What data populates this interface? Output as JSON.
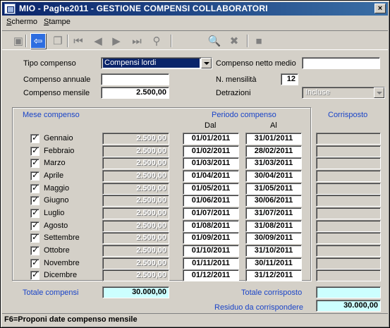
{
  "window": {
    "title": "MIO - Paghe2011 - GESTIONE COMPENSI COLLABORATORI",
    "close_label": "×"
  },
  "menu": [
    {
      "underline": "S",
      "rest": "chermo"
    },
    {
      "underline": "S",
      "rest": "tampe"
    }
  ],
  "toolbar": [
    {
      "name": "save-icon",
      "glyph": "▣",
      "active": false
    },
    {
      "name": "back-arrow-icon",
      "glyph": "⇦",
      "active": true
    },
    {
      "name": "pages-icon",
      "glyph": "❐",
      "active": false
    },
    {
      "name": "first-record-icon",
      "glyph": "⏮",
      "active": false
    },
    {
      "name": "previous-record-icon",
      "glyph": "◀",
      "active": false
    },
    {
      "name": "next-record-icon",
      "glyph": "▶",
      "active": false
    },
    {
      "name": "last-record-icon",
      "glyph": "⏭",
      "active": false
    },
    {
      "name": "binoculars-icon",
      "glyph": "⚲",
      "active": false
    },
    {
      "name": "search-icon",
      "glyph": "🔍",
      "active": false
    },
    {
      "name": "delete-record-icon",
      "glyph": "✖",
      "active": false
    },
    {
      "name": "stop-icon",
      "glyph": "■",
      "active": false
    }
  ],
  "form": {
    "tipo_compenso_label": "Tipo compenso",
    "tipo_compenso_value": "Compensi lordi",
    "compenso_netto_medio_label": "Compenso netto medio",
    "compenso_netto_medio_value": "",
    "compenso_annuale_label": "Compenso annuale",
    "compenso_annuale_value": "",
    "n_mensilita_label": "N. mensilità",
    "n_mensilita_value": "12",
    "compenso_mensile_label": "Compenso mensile",
    "compenso_mensile_value": "2.500,00",
    "detrazioni_label": "Detrazioni",
    "detrazioni_value": "Incluse"
  },
  "table": {
    "mese_header": "Mese compenso",
    "periodo_header": "Periodo compenso",
    "dal_header": "Dal",
    "al_header": "Al",
    "corrisposto_header": "Corrisposto",
    "rows": [
      {
        "month": "Gennaio",
        "checked": true,
        "amount": "2.500,00",
        "dal": "01/01/2011",
        "al": "31/01/2011",
        "corrisposto": ""
      },
      {
        "month": "Febbraio",
        "checked": true,
        "amount": "2.500,00",
        "dal": "01/02/2011",
        "al": "28/02/2011",
        "corrisposto": ""
      },
      {
        "month": "Marzo",
        "checked": true,
        "amount": "2.500,00",
        "dal": "01/03/2011",
        "al": "31/03/2011",
        "corrisposto": ""
      },
      {
        "month": "Aprile",
        "checked": true,
        "amount": "2.500,00",
        "dal": "01/04/2011",
        "al": "30/04/2011",
        "corrisposto": ""
      },
      {
        "month": "Maggio",
        "checked": true,
        "amount": "2.500,00",
        "dal": "01/05/2011",
        "al": "31/05/2011",
        "corrisposto": ""
      },
      {
        "month": "Giugno",
        "checked": true,
        "amount": "2.500,00",
        "dal": "01/06/2011",
        "al": "30/06/2011",
        "corrisposto": ""
      },
      {
        "month": "Luglio",
        "checked": true,
        "amount": "2.500,00",
        "dal": "01/07/2011",
        "al": "31/07/2011",
        "corrisposto": ""
      },
      {
        "month": "Agosto",
        "checked": true,
        "amount": "2.500,00",
        "dal": "01/08/2011",
        "al": "31/08/2011",
        "corrisposto": ""
      },
      {
        "month": "Settembre",
        "checked": true,
        "amount": "2.500,00",
        "dal": "01/09/2011",
        "al": "30/09/2011",
        "corrisposto": ""
      },
      {
        "month": "Ottobre",
        "checked": true,
        "amount": "2.500,00",
        "dal": "01/10/2011",
        "al": "31/10/2011",
        "corrisposto": ""
      },
      {
        "month": "Novembre",
        "checked": true,
        "amount": "2.500,00",
        "dal": "01/11/2011",
        "al": "30/11/2011",
        "corrisposto": ""
      },
      {
        "month": "Dicembre",
        "checked": true,
        "amount": "2.500,00",
        "dal": "01/12/2011",
        "al": "31/12/2011",
        "corrisposto": ""
      }
    ]
  },
  "totals": {
    "totale_compensi_label": "Totale compensi",
    "totale_compensi_value": "30.000,00",
    "totale_corrisposto_label": "Totale corrisposto",
    "totale_corrisposto_value": "",
    "residuo_label": "Residuo da corrispondere",
    "residuo_value": "30.000,00"
  },
  "status": {
    "hint": "F6=Proponi date compenso mensile"
  }
}
